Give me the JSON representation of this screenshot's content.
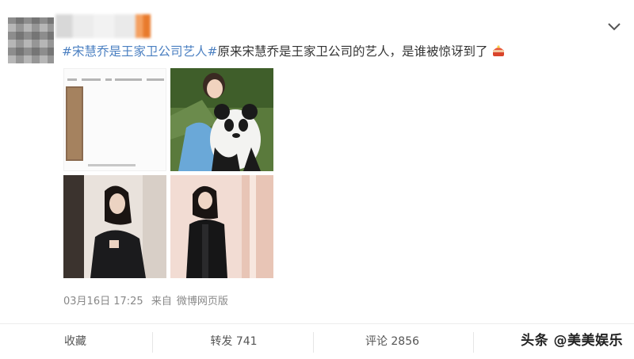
{
  "post": {
    "topic": "#宋慧乔是王家卫公司艺人#",
    "body": "原来宋慧乔是王家卫公司的艺人，是谁被惊讶到了",
    "emoji": "cake-emoji"
  },
  "images": [
    {
      "name": "post-image-1"
    },
    {
      "name": "post-image-2"
    },
    {
      "name": "post-image-3"
    },
    {
      "name": "post-image-4"
    }
  ],
  "meta": {
    "time": "03月16日 17:25",
    "from_prefix": "来自",
    "source": "微博网页版"
  },
  "actions": {
    "favorite": "收藏",
    "repost": "转发 741",
    "comment": "评论 2856"
  },
  "watermark": "头条 @美美娱乐",
  "colors": {
    "topic": "#4a7fc1",
    "meta": "#888888"
  }
}
